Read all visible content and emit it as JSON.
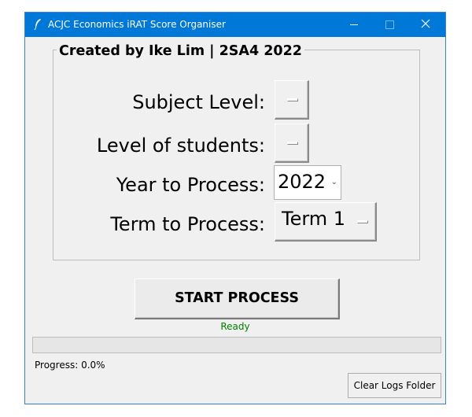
{
  "window": {
    "title": "ACJC Economics iRAT Score Organiser",
    "icon": "feather-icon",
    "accent_color": "#0078d7"
  },
  "group": {
    "label": "Created by Ike Lim | 2SA4 2022"
  },
  "fields": {
    "subject_level": {
      "label": "Subject Level:",
      "value": ""
    },
    "level_of_students": {
      "label": "Level of students:",
      "value": ""
    },
    "year": {
      "label": "Year to Process:",
      "value": "2022"
    },
    "term": {
      "label": "Term to Process:",
      "value": "Term 1"
    }
  },
  "start_button": {
    "label": "START PROCESS"
  },
  "status": {
    "text": "Ready",
    "color": "#008000"
  },
  "progress": {
    "value": 0.0,
    "text": "Progress: 0.0%"
  },
  "clear_button": {
    "label": "Clear Logs Folder"
  }
}
